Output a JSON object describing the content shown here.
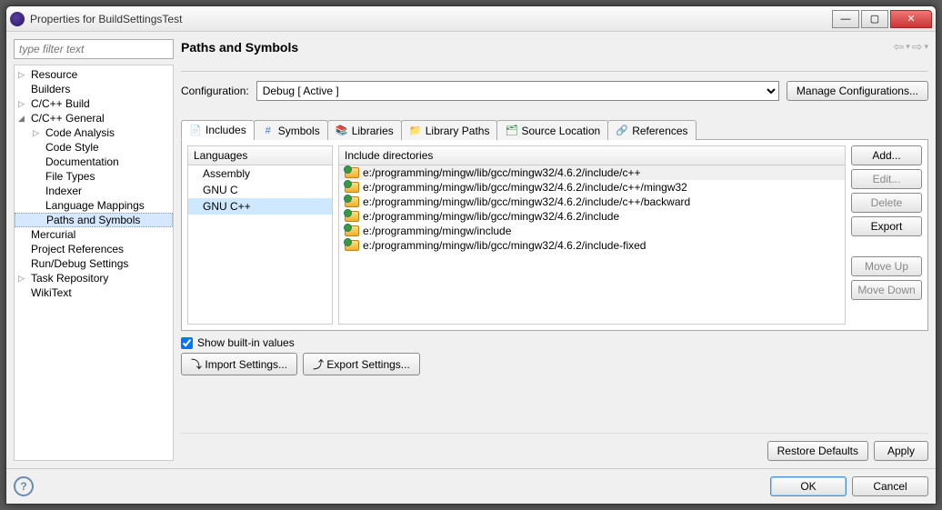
{
  "window": {
    "title": "Properties for BuildSettingsTest"
  },
  "filter_placeholder": "type filter text",
  "tree": [
    {
      "label": "Resource",
      "depth": 0,
      "arrow": "▷"
    },
    {
      "label": "Builders",
      "depth": 0
    },
    {
      "label": "C/C++ Build",
      "depth": 0,
      "arrow": "▷"
    },
    {
      "label": "C/C++ General",
      "depth": 0,
      "arrow": "◢"
    },
    {
      "label": "Code Analysis",
      "depth": 1,
      "arrow": "▷"
    },
    {
      "label": "Code Style",
      "depth": 1
    },
    {
      "label": "Documentation",
      "depth": 1
    },
    {
      "label": "File Types",
      "depth": 1
    },
    {
      "label": "Indexer",
      "depth": 1
    },
    {
      "label": "Language Mappings",
      "depth": 1
    },
    {
      "label": "Paths and Symbols",
      "depth": 1,
      "selected": true
    },
    {
      "label": "Mercurial",
      "depth": 0
    },
    {
      "label": "Project References",
      "depth": 0
    },
    {
      "label": "Run/Debug Settings",
      "depth": 0
    },
    {
      "label": "Task Repository",
      "depth": 0,
      "arrow": "▷"
    },
    {
      "label": "WikiText",
      "depth": 0
    }
  ],
  "page_title": "Paths and Symbols",
  "config": {
    "label": "Configuration:",
    "value": "Debug  [ Active ]",
    "manage": "Manage Configurations..."
  },
  "tabs": [
    {
      "label": "Includes",
      "active": true,
      "iconColor": "#2a7a2a",
      "iconChar": "📄"
    },
    {
      "label": "Symbols",
      "iconColor": "#3a7ac0",
      "iconChar": "#"
    },
    {
      "label": "Libraries",
      "iconColor": "#b07020",
      "iconChar": "📚"
    },
    {
      "label": "Library Paths",
      "iconColor": "#b07020",
      "iconChar": "📁"
    },
    {
      "label": "Source Location",
      "iconColor": "#2a7a2a",
      "iconChar": "🗂"
    },
    {
      "label": "References",
      "iconColor": "#3a7ac0",
      "iconChar": "🔗"
    }
  ],
  "languages": {
    "header": "Languages",
    "items": [
      "Assembly",
      "GNU C",
      "GNU C++"
    ],
    "selected": 2
  },
  "includes": {
    "header": "Include directories",
    "items": [
      "e:/programming/mingw/lib/gcc/mingw32/4.6.2/include/c++",
      "e:/programming/mingw/lib/gcc/mingw32/4.6.2/include/c++/mingw32",
      "e:/programming/mingw/lib/gcc/mingw32/4.6.2/include/c++/backward",
      "e:/programming/mingw/lib/gcc/mingw32/4.6.2/include",
      "e:/programming/mingw/include",
      "e:/programming/mingw/lib/gcc/mingw32/4.6.2/include-fixed"
    ]
  },
  "side_buttons": {
    "add": "Add...",
    "edit": "Edit...",
    "delete": "Delete",
    "export": "Export",
    "moveup": "Move Up",
    "movedown": "Move Down"
  },
  "show_builtin": "Show built-in values",
  "import_btn": "Import Settings...",
  "export_btn": "Export Settings...",
  "footer": {
    "restore": "Restore Defaults",
    "apply": "Apply"
  },
  "bottom": {
    "ok": "OK",
    "cancel": "Cancel"
  }
}
